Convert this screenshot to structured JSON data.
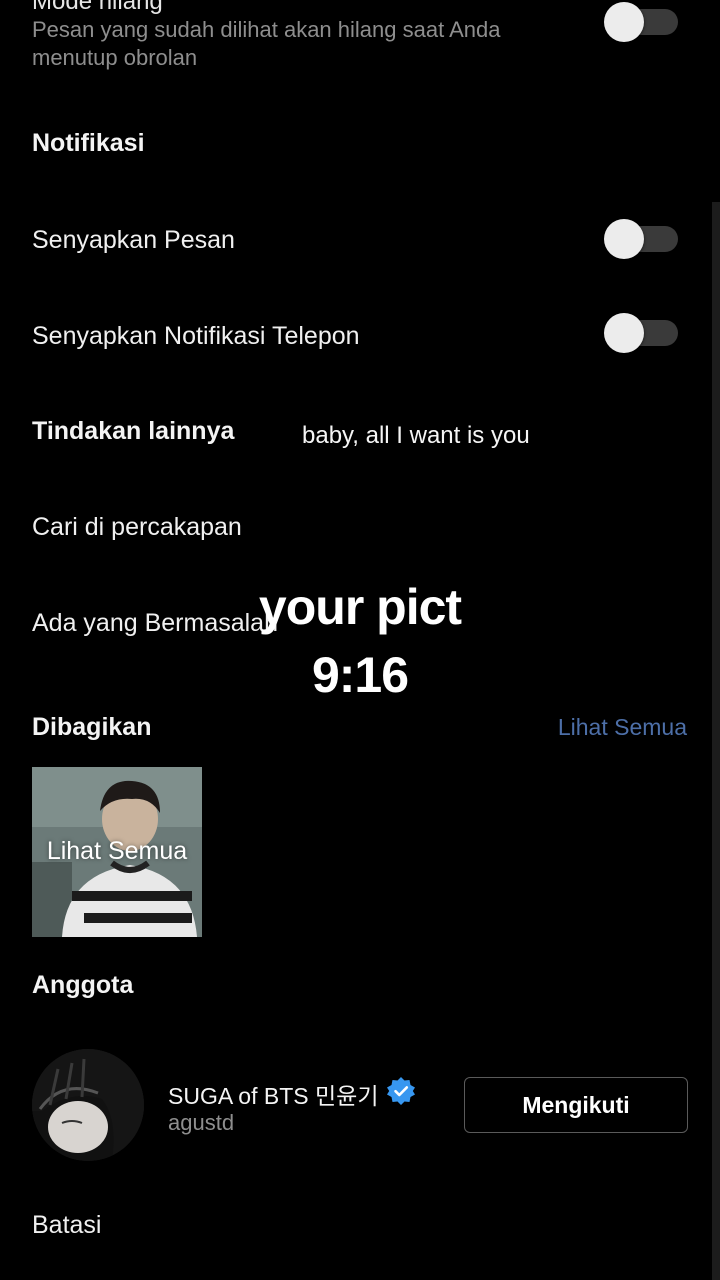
{
  "disappearing": {
    "title": "Mode hilang",
    "description": "Pesan yang sudah dilihat akan hilang saat Anda menutup obrolan",
    "enabled": false
  },
  "notifications": {
    "heading": "Notifikasi",
    "mute_messages": {
      "label": "Senyapkan Pesan",
      "enabled": false
    },
    "mute_calls": {
      "label": "Senyapkan Notifikasi Telepon",
      "enabled": false
    }
  },
  "more_actions": {
    "heading": "Tindakan lainnya",
    "search": "Cari di percakapan",
    "report": "Ada yang Bermasalah"
  },
  "shared": {
    "heading": "Dibagikan",
    "see_all": "Lihat Semua",
    "thumb_caption": "Lihat Semua"
  },
  "members": {
    "heading": "Anggota",
    "items": [
      {
        "name": "SUGA of BTS 민윤기",
        "handle": "agustd",
        "verified": true,
        "button": "Mengikuti"
      }
    ]
  },
  "restrict": {
    "label": "Batasi"
  },
  "overlay": {
    "lyric": "baby, all I want is you",
    "line1": "your pict",
    "line2": "9:16"
  },
  "colors": {
    "background": "#000000",
    "link": "#4d6fa8",
    "verified": "#3797f0",
    "toggle_track": "#3a3a3a",
    "toggle_knob": "#ececec"
  }
}
